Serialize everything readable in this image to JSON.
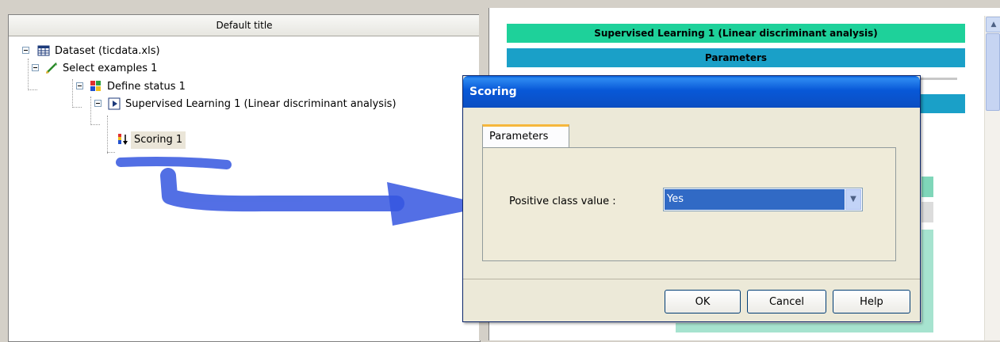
{
  "left_panel": {
    "title": "Default title",
    "tree": [
      {
        "label": "Dataset (ticdata.xls)",
        "icon": "table-icon"
      },
      {
        "label": "Select examples 1",
        "icon": "pencil-icon"
      },
      {
        "label": "Define status 1",
        "icon": "puzzle-icon"
      },
      {
        "label": "Supervised Learning 1 (Linear discriminant analysis)",
        "icon": "play-icon"
      },
      {
        "label": "Scoring 1",
        "icon": "scoring-icon"
      }
    ]
  },
  "report": {
    "header": "Supervised Learning 1 (Linear discriminant analysis)",
    "section": "Parameters",
    "colors": {
      "header_bg": "#1ed19a",
      "section_bg": "#1aa0c8"
    }
  },
  "dialog": {
    "title": "Scoring",
    "tab": "Parameters",
    "field_label": "Positive class value :",
    "field_value": "Yes",
    "buttons": {
      "ok": "OK",
      "cancel": "Cancel",
      "help": "Help"
    }
  },
  "colors": {
    "annotation_arrow": "#3556e0",
    "titlebar": "#0b57d0",
    "selected": "#316ac5"
  }
}
